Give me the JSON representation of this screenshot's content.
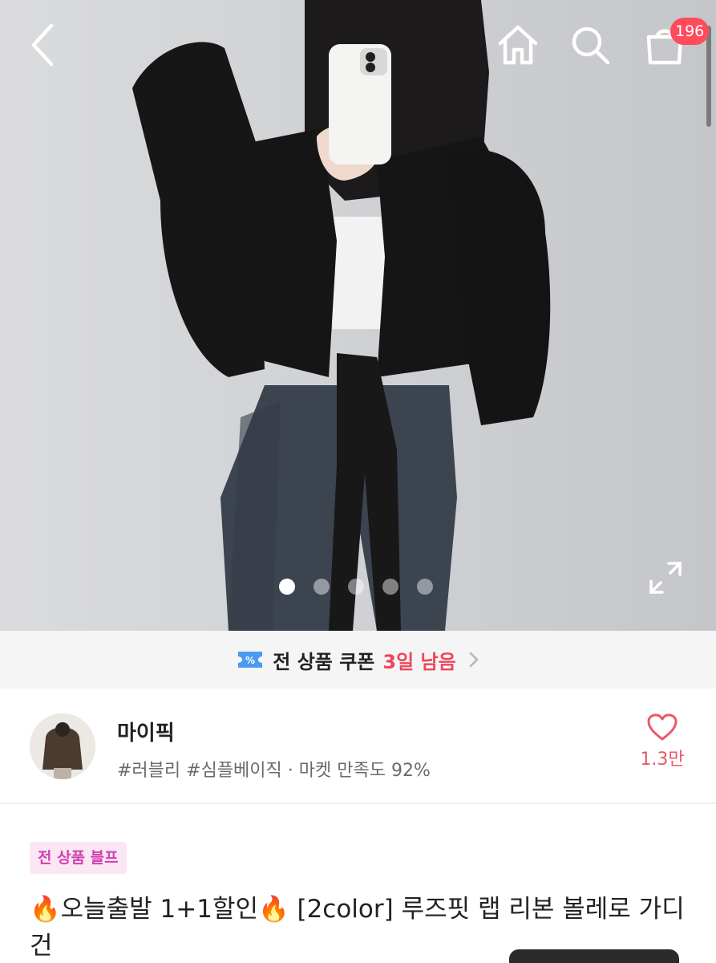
{
  "header": {
    "back_icon": "chevron-left-icon",
    "home_icon": "home-icon",
    "search_icon": "search-icon",
    "cart_icon": "shopping-bag-icon",
    "cart_count": "196"
  },
  "gallery": {
    "image_count": 5,
    "active_index": 0,
    "expand_icon": "expand-icon"
  },
  "coupon": {
    "label": "전 상품 쿠폰",
    "days_left": "3일 남음"
  },
  "shop": {
    "name": "마이픽",
    "tags": "#러블리 #심플베이직 · 마켓 만족도 92%",
    "like_count": "1.3만"
  },
  "product": {
    "promo_badge": "전 상품 블프",
    "title_part1": "오늘출발 1+1할인",
    "title_part2": " [2color] 루즈핏 랩 리본 볼레로 가디건",
    "fire_emoji": "🔥"
  },
  "colors": {
    "accent_red": "#f0455a",
    "badge_red": "#ff4b5c",
    "promo_pink": "#d23fb2",
    "like_pink": "#e8596a"
  }
}
